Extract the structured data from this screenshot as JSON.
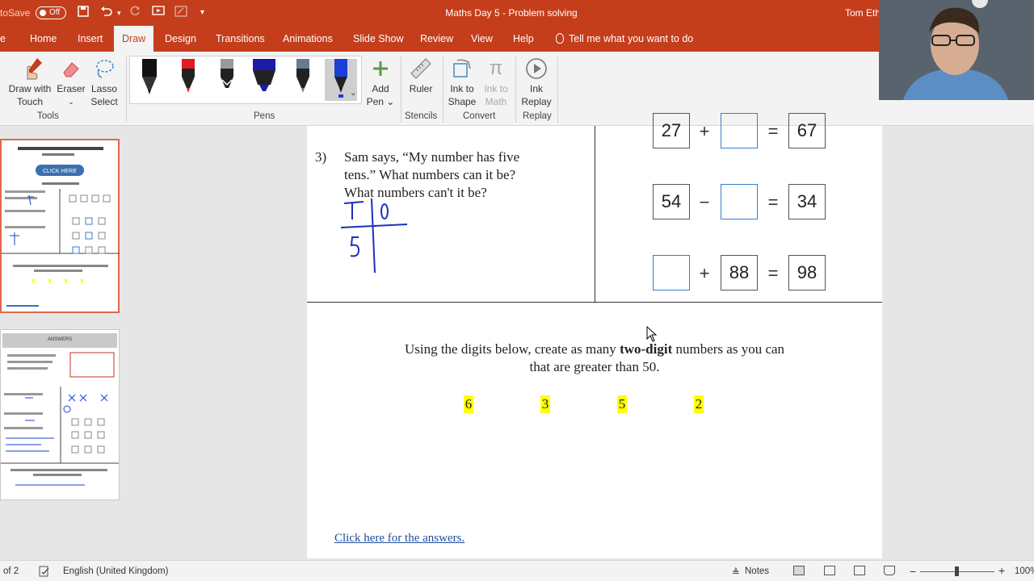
{
  "titlebar": {
    "autosave_label": "toSave",
    "autosave_state": "Off",
    "doc_title": "Maths Day 5  -  Problem solving",
    "user": "Tom Eth"
  },
  "tabs": [
    "Home",
    "Insert",
    "Draw",
    "Design",
    "Transitions",
    "Animations",
    "Slide Show",
    "Review",
    "View",
    "Help"
  ],
  "active_tab": "Draw",
  "tell_me": "Tell me what you want to do",
  "ribbon": {
    "tools": {
      "draw_with_touch": [
        "Draw with",
        "Touch"
      ],
      "eraser": [
        "Eraser",
        "⌄"
      ],
      "lasso": [
        "Lasso",
        "Select"
      ],
      "group": "Tools"
    },
    "pens_group": "Pens",
    "add_pen": [
      "Add",
      "Pen ⌄"
    ],
    "ruler": "Ruler",
    "stencils_group": "Stencils",
    "ink_to_shape": [
      "Ink to",
      "Shape"
    ],
    "ink_to_math": [
      "Ink to",
      "Math"
    ],
    "convert_group": "Convert",
    "ink_replay": [
      "Ink",
      "Replay"
    ],
    "replay_group": "Replay",
    "pens": [
      {
        "color": "#111111"
      },
      {
        "color": "#e01b24"
      },
      {
        "color": "#9a9a9a"
      },
      {
        "color": "#1c1ca8"
      },
      {
        "color": "#6a7a8a"
      },
      {
        "color": "#1a3fd6"
      }
    ]
  },
  "slide": {
    "q3_number": "3)",
    "q3_lines": [
      "Sam says, “My number has five",
      "tens.” What numbers can it be?",
      "What numbers can't it be?"
    ],
    "handwriting": {
      "T": "T",
      "O": "0",
      "five": "5"
    },
    "equations": [
      {
        "a": "27",
        "op": "+",
        "b": "",
        "eq": "=",
        "c": "67"
      },
      {
        "a": "54",
        "op": "−",
        "b": "",
        "eq": "=",
        "c": "34"
      },
      {
        "a": "",
        "op": "+",
        "b": "88",
        "eq": "=",
        "c": "98"
      }
    ],
    "instruction_pre": "Using the digits below, create as many ",
    "instruction_bold": "two-digit",
    "instruction_post": " numbers as you can",
    "instruction_line2": "that are greater than 50.",
    "digits": [
      "6",
      "3",
      "5",
      "2"
    ],
    "answers_link": "Click here for the answers."
  },
  "thumbnails": {
    "slide1_button": "CLICK HERE",
    "slide2_header": "ANSWERS"
  },
  "statusbar": {
    "slide_count": "of 2",
    "language": "English (United Kingdom)",
    "notes": "Notes",
    "zoom": "100%",
    "minus": "−",
    "plus": "+"
  }
}
